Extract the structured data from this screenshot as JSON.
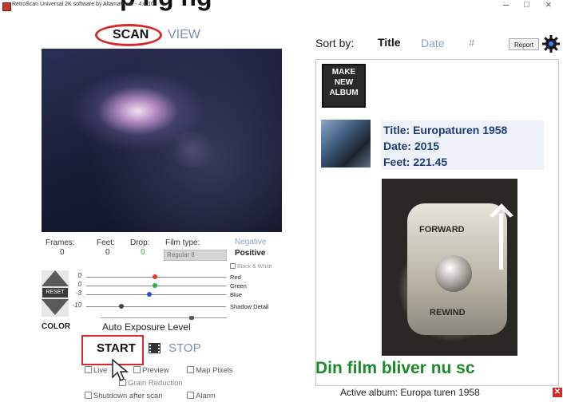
{
  "banner": {
    "text": "p   ng ng"
  },
  "window": {
    "title": "RetroScan Universal 2K software by AltamaWare - 4.0.10",
    "minimize": "–",
    "maximize": "□",
    "close": "×"
  },
  "tabs": {
    "scan": "SCAN",
    "view": "VIEW"
  },
  "stats": {
    "frames_label": "Frames:",
    "frames_value": "0",
    "feet_label": "Feet:",
    "feet_value": "0",
    "drop_label": "Drop:",
    "drop_value": "0",
    "filmtype_label": "Film type:",
    "filmtype_value": "Regular 8",
    "negative": "Negative",
    "positive": "Positive",
    "bw": "Black & White"
  },
  "sliders": [
    {
      "value": "0",
      "name": "Red",
      "color": "#e23a2a",
      "position": 0.49
    },
    {
      "value": "0",
      "name": "Green",
      "color": "#2fae3a",
      "position": 0.49
    },
    {
      "value": "-3",
      "name": "Blue",
      "color": "#2a52d6",
      "position": 0.45
    },
    {
      "value": "-10",
      "name": "Shadow Detail",
      "color": "#444444",
      "position": 0.25
    }
  ],
  "reset_label": "RESET",
  "color_label": "COLOR",
  "auto_exposure": {
    "label": "Auto Exposure Level",
    "position": 0.72
  },
  "controls": {
    "start": "START",
    "stop": "STOP"
  },
  "options": {
    "live": "Live",
    "preview": "Preview",
    "map_pixels": "Map Pixels",
    "grain_reduction": "Grain Reduction",
    "shutdown": "Shutdown after scan",
    "alarm": "Alarm"
  },
  "sort": {
    "label": "Sort by:",
    "title": "Title",
    "date": "Date",
    "number": "#",
    "report": "Report"
  },
  "make_album": {
    "line1": "MAKE",
    "line2": "NEW",
    "line3": "ALBUM"
  },
  "album": {
    "title": "Title: Europaturen 1958",
    "date": "Date: 2015",
    "feet": "Feet: 221.45"
  },
  "frame_text": {
    "forward": "FORWARD",
    "rewind": "REWIND"
  },
  "overlay_text": "Din film bliver nu sc",
  "active_album": "Active album: Europa turen 1958",
  "colors": {
    "accent_red": "#d42a2a",
    "link_blue": "#7b8fb3",
    "title_blue": "#1d3d7a",
    "green": "#1a8a2a"
  }
}
